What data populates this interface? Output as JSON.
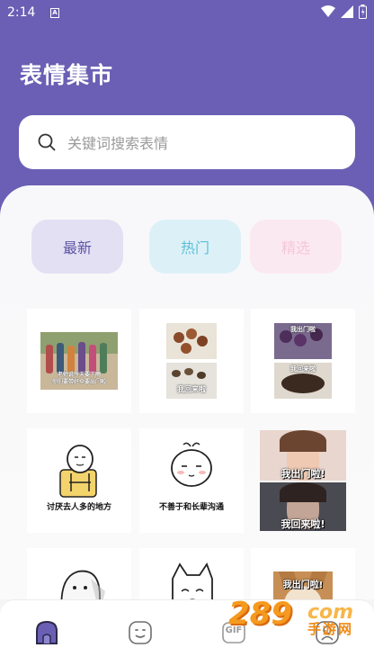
{
  "status_bar": {
    "time": "2:14",
    "app_indicator": "A"
  },
  "header": {
    "title": "表情集市"
  },
  "search": {
    "placeholder": "关键词搜索表情",
    "icon": "search-icon"
  },
  "categories": [
    {
      "label": "最新",
      "selected": true
    },
    {
      "label": "热门",
      "selected": false
    },
    {
      "label": "精选",
      "selected": false
    }
  ],
  "stickers": [
    {
      "caption": ""
    },
    {
      "caption": "我回来啦"
    },
    {
      "caption": "我回来啦"
    },
    {
      "caption": "讨厌去人多的地方"
    },
    {
      "caption": "不善于和长辈沟通"
    },
    {
      "caption_top": "我出门啦!",
      "caption_bottom": "我回来啦!"
    },
    {
      "caption": ""
    },
    {
      "caption": ""
    },
    {
      "caption": "我出门啦!"
    }
  ],
  "group_photo_caption": {
    "line1": "老师说今天要下雨",
    "line2": "你们要带好伞要出门啦"
  },
  "grape_caption_top": "我出门啦",
  "tabbar": [
    {
      "name": "home-tab",
      "icon": "house-icon"
    },
    {
      "name": "emoji-tab",
      "icon": "smiley-icon"
    },
    {
      "name": "gif-tab",
      "icon": "gif-icon",
      "label": "GIF"
    },
    {
      "name": "profile-tab",
      "icon": "person-icon"
    }
  ],
  "watermark": {
    "number": "289",
    "suffix": "com",
    "text": "手游网"
  },
  "colors": {
    "header_bg": "#6a5fb4",
    "chip_new": "#e3e0f3",
    "chip_hot": "#dcf1f7",
    "chip_pick": "#fbe9f1"
  }
}
